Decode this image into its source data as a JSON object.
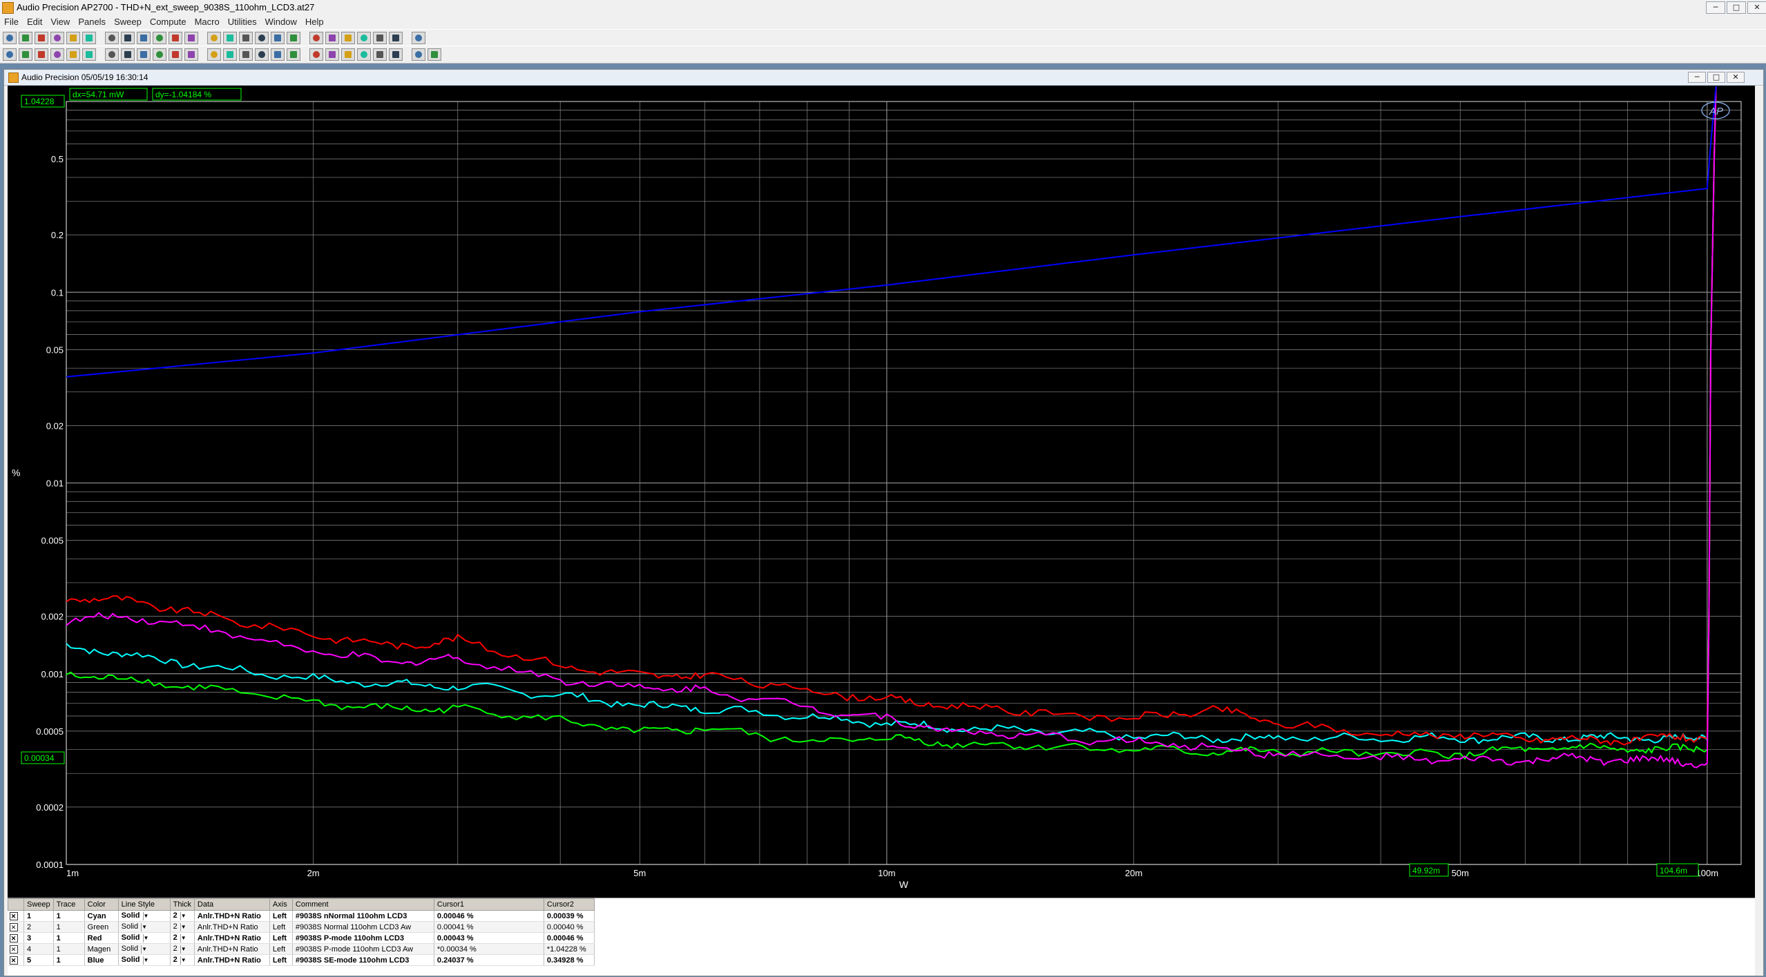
{
  "window": {
    "title": "Audio Precision AP2700 - THD+N_ext_sweep_9038S_110ohm_LCD3.at27",
    "controls": [
      "─",
      "□",
      "✕"
    ]
  },
  "menu": [
    "File",
    "Edit",
    "View",
    "Panels",
    "Sweep",
    "Compute",
    "Macro",
    "Utilities",
    "Window",
    "Help"
  ],
  "toolbar1": [
    "new-icon",
    "open-icon",
    "open-test-icon",
    "save-icon",
    "save-as-icon",
    "print-icon",
    "print-preview-icon",
    "undo-icon",
    "cut-icon",
    "copy-icon",
    "paste-icon",
    "go-icon",
    "stop-icon",
    "panel-icon",
    "find-icon",
    "settings-icon",
    "graph-icon",
    "play-icon",
    "pause-icon",
    "stop-sweep-icon",
    "hand-icon",
    "glasses-icon",
    "zoom-in-icon",
    "zoom-out-icon",
    "redo-icon"
  ],
  "toolbar2": [
    "graph-view-icon",
    "cursor-icon",
    "scale-icon",
    "transfer-icon",
    "analyzer-icon",
    "generator-icon",
    "switcher-icon",
    "dsp-icon",
    "speaker-icon",
    "meter-icon",
    "signal-icon",
    "sweep-icon",
    "compute-icon",
    "filter-icon",
    "arrow-right-icon",
    "arrow-down-icon",
    "chart-icon",
    "table-icon",
    "export-icon",
    "panel-a-icon",
    "panel-b-icon",
    "panel-c-icon",
    "panel-d-icon",
    "panel-e-icon",
    "panel-f-icon",
    "panel-g-icon"
  ],
  "child_window": {
    "title": "Audio Precision  05/05/19 16:30:14",
    "controls": [
      "─",
      "□",
      "✕"
    ]
  },
  "graph": {
    "logo": "AP",
    "readout_y": "1.04228",
    "dx": "dx=54.71   mW",
    "dy": "dy=-1.04184 %",
    "cursor2_y": "0.00034",
    "cursor1_x": "49.92m",
    "cursor2_x": "104.6m"
  },
  "chart_data": {
    "type": "line",
    "xlabel": "W",
    "ylabel": "%",
    "xscale": "log",
    "yscale": "log",
    "xlim": [
      0.001,
      0.11
    ],
    "ylim": [
      0.0001,
      1.0
    ],
    "x_ticks": [
      "1m",
      "2m",
      "5m",
      "10m",
      "20m",
      "50m",
      "100m"
    ],
    "y_ticks": [
      "0.5",
      "0.2",
      "0.1",
      "0.05",
      "0.02",
      "0.01",
      "0.005",
      "0.002",
      "0.001",
      "0.0005",
      "0.0002",
      "0.0001"
    ],
    "grid": true,
    "series": [
      {
        "name": "#9038S nNormal 110ohm LCD3",
        "color": "#00ffff",
        "x": [
          0.001,
          0.0012,
          0.0015,
          0.002,
          0.0025,
          0.003,
          0.004,
          0.005,
          0.006,
          0.008,
          0.01,
          0.012,
          0.015,
          0.02,
          0.025,
          0.03,
          0.04,
          0.05,
          0.06,
          0.07,
          0.08,
          0.09,
          0.1,
          0.1005,
          0.101,
          0.102,
          0.1025
        ],
        "y": [
          0.0014,
          0.00125,
          0.00108,
          0.00094,
          0.00088,
          0.00086,
          0.00077,
          0.00068,
          0.00066,
          0.0006,
          0.00055,
          0.00052,
          0.0005,
          0.00047,
          0.00046,
          0.00046,
          0.00046,
          0.00046,
          0.00046,
          0.00046,
          0.00046,
          0.00046,
          0.00045,
          0.002,
          0.05,
          0.5,
          1.2
        ]
      },
      {
        "name": "#9038S Normal 110ohm LCD3 Aw",
        "color": "#00ff00",
        "x": [
          0.001,
          0.0012,
          0.0015,
          0.002,
          0.0025,
          0.003,
          0.004,
          0.005,
          0.006,
          0.008,
          0.01,
          0.012,
          0.015,
          0.02,
          0.025,
          0.03,
          0.04,
          0.05,
          0.06,
          0.07,
          0.08,
          0.09,
          0.1,
          0.1005,
          0.101,
          0.102,
          0.1025
        ],
        "y": [
          0.001,
          0.00093,
          0.00083,
          0.00071,
          0.00065,
          0.00066,
          0.00057,
          0.00049,
          0.00052,
          0.00044,
          0.00046,
          0.00043,
          0.00042,
          0.0004,
          0.00039,
          0.00039,
          0.00038,
          0.00038,
          0.0004,
          0.00041,
          0.0004,
          0.0004,
          0.0004,
          0.002,
          0.05,
          0.5,
          1.2
        ]
      },
      {
        "name": "#9038S P-mode 110ohm LCD3",
        "color": "#ff0000",
        "x": [
          0.001,
          0.0012,
          0.0015,
          0.002,
          0.0025,
          0.003,
          0.004,
          0.005,
          0.006,
          0.008,
          0.01,
          0.012,
          0.015,
          0.02,
          0.025,
          0.03,
          0.04,
          0.05,
          0.06,
          0.07,
          0.08,
          0.09,
          0.1,
          0.1005,
          0.101,
          0.102,
          0.1025
        ],
        "y": [
          0.0025,
          0.0024,
          0.002,
          0.0016,
          0.0014,
          0.0015,
          0.0011,
          0.00098,
          0.00098,
          0.00082,
          0.00073,
          0.00068,
          0.00063,
          0.00058,
          0.00065,
          0.00055,
          0.00048,
          0.00048,
          0.00046,
          0.00045,
          0.00045,
          0.00046,
          0.00046,
          0.002,
          0.05,
          0.5,
          1.2
        ]
      },
      {
        "name": "#9038S P-mode 110ohm LCD3 Aw",
        "color": "#ff00ff",
        "x": [
          0.001,
          0.0012,
          0.0015,
          0.002,
          0.0025,
          0.003,
          0.004,
          0.005,
          0.006,
          0.008,
          0.01,
          0.012,
          0.015,
          0.02,
          0.025,
          0.03,
          0.04,
          0.05,
          0.06,
          0.07,
          0.08,
          0.09,
          0.1,
          0.1005,
          0.101,
          0.102,
          0.1025
        ],
        "y": [
          0.0019,
          0.002,
          0.0017,
          0.0013,
          0.00115,
          0.0012,
          0.00093,
          0.00085,
          0.00082,
          0.00067,
          0.00058,
          0.0005,
          0.00047,
          0.00044,
          0.00041,
          0.00038,
          0.00036,
          0.00035,
          0.00035,
          0.00036,
          0.00035,
          0.00035,
          0.00034,
          0.002,
          0.05,
          0.5,
          1.2
        ]
      },
      {
        "name": "#9038S SE-mode 110ohm LCD3",
        "color": "#0000ff",
        "x": [
          0.001,
          0.002,
          0.005,
          0.01,
          0.02,
          0.05,
          0.1,
          0.101,
          0.1025
        ],
        "y": [
          0.036,
          0.048,
          0.079,
          0.109,
          0.157,
          0.249,
          0.35,
          0.6,
          1.2
        ]
      }
    ]
  },
  "legend": {
    "headers": [
      "Sweep",
      "Trace",
      "Color",
      "Line Style",
      "Thick",
      "Data",
      "Axis",
      "Comment",
      "Cursor1",
      "Cursor2"
    ],
    "rows": [
      {
        "sweep": "1",
        "trace": "1",
        "color": "Cyan",
        "style": "Solid",
        "thick": "2",
        "data": "Anlr.THD+N Ratio",
        "axis": "Left",
        "comment": "#9038S nNormal 110ohm LCD3",
        "c1": "0.00046  %",
        "c2": "0.00039  %",
        "bold": true
      },
      {
        "sweep": "2",
        "trace": "1",
        "color": "Green",
        "style": "Solid",
        "thick": "2",
        "data": "Anlr.THD+N Ratio",
        "axis": "Left",
        "comment": "#9038S Normal 110ohm LCD3 Aw",
        "c1": "0.00041  %",
        "c2": "0.00040  %",
        "bold": false
      },
      {
        "sweep": "3",
        "trace": "1",
        "color": "Red",
        "style": "Solid",
        "thick": "2",
        "data": "Anlr.THD+N Ratio",
        "axis": "Left",
        "comment": "#9038S P-mode 110ohm LCD3",
        "c1": "0.00043  %",
        "c2": "0.00046  %",
        "bold": true
      },
      {
        "sweep": "4",
        "trace": "1",
        "color": "Magen",
        "style": "Solid",
        "thick": "2",
        "data": "Anlr.THD+N Ratio",
        "axis": "Left",
        "comment": "#9038S P-mode 110ohm LCD3 Aw",
        "c1": "*0.00034  %",
        "c2": "*1.04228  %",
        "bold": false
      },
      {
        "sweep": "5",
        "trace": "1",
        "color": "Blue",
        "style": "Solid",
        "thick": "2",
        "data": "Anlr.THD+N Ratio",
        "axis": "Left",
        "comment": "#9038S SE-mode 110ohm LCD3",
        "c1": "0.24037  %",
        "c2": "0.34928  %",
        "bold": true
      }
    ]
  }
}
